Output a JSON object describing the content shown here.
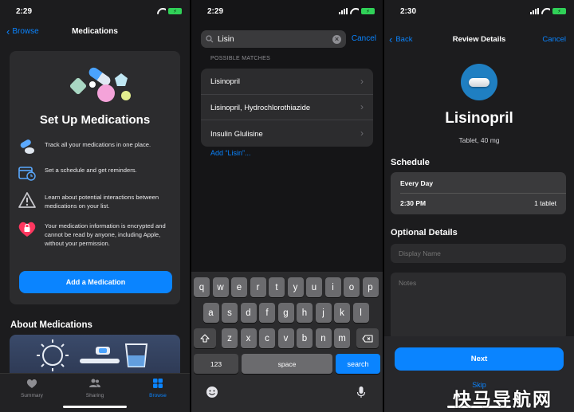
{
  "colors": {
    "accent": "#0a84ff",
    "battery": "#30d158",
    "medicine_badge": "#1f7fc2"
  },
  "screen1": {
    "status_time": "2:29",
    "nav": {
      "back_label": "Browse",
      "title": "Medications"
    },
    "setup": {
      "title": "Set Up Medications",
      "features": [
        {
          "icon": "pills-icon",
          "text": "Track all your medications in one place."
        },
        {
          "icon": "calendar-clock-icon",
          "text": "Set a schedule and get reminders."
        },
        {
          "icon": "warning-triangle-icon",
          "text": "Learn about potential interactions between medications on your list."
        },
        {
          "icon": "lock-heart-icon",
          "text": "Your medication information is encrypted and cannot be read by anyone, including Apple, without your permission."
        }
      ],
      "add_button": "Add a Medication"
    },
    "about_title": "About Medications",
    "tabs": [
      {
        "label": "Summary",
        "icon": "heart-icon"
      },
      {
        "label": "Sharing",
        "icon": "people-icon"
      },
      {
        "label": "Browse",
        "icon": "grid-icon",
        "selected": true
      }
    ]
  },
  "screen2": {
    "status_time": "2:29",
    "search": {
      "value": "Lisin",
      "cancel_label": "Cancel"
    },
    "section_header": "POSSIBLE MATCHES",
    "matches": [
      "Lisinopril",
      "Lisinopril, Hydrochlorothiazide",
      "Insulin Glulisine"
    ],
    "add_custom": "Add “Lisin”...",
    "keyboard": {
      "row1": [
        "q",
        "w",
        "e",
        "r",
        "t",
        "y",
        "u",
        "i",
        "o",
        "p"
      ],
      "row2": [
        "a",
        "s",
        "d",
        "f",
        "g",
        "h",
        "j",
        "k",
        "l"
      ],
      "row3": [
        "z",
        "x",
        "c",
        "v",
        "b",
        "n",
        "m"
      ],
      "numbers_key": "123",
      "space_key": "space",
      "search_key": "search"
    }
  },
  "screen3": {
    "status_time": "2:30",
    "nav": {
      "back_label": "Back",
      "title": "Review Details",
      "cancel_label": "Cancel"
    },
    "medication": {
      "name": "Lisinopril",
      "form": "Tablet, 40 mg"
    },
    "schedule_heading": "Schedule",
    "schedule": {
      "frequency": "Every Day",
      "time": "2:30 PM",
      "dose": "1 tablet"
    },
    "optional_heading": "Optional Details",
    "display_name_placeholder": "Display Name",
    "notes_placeholder": "Notes",
    "next_button": "Next",
    "skip_label": "Skip"
  },
  "watermark": "快马导航网"
}
